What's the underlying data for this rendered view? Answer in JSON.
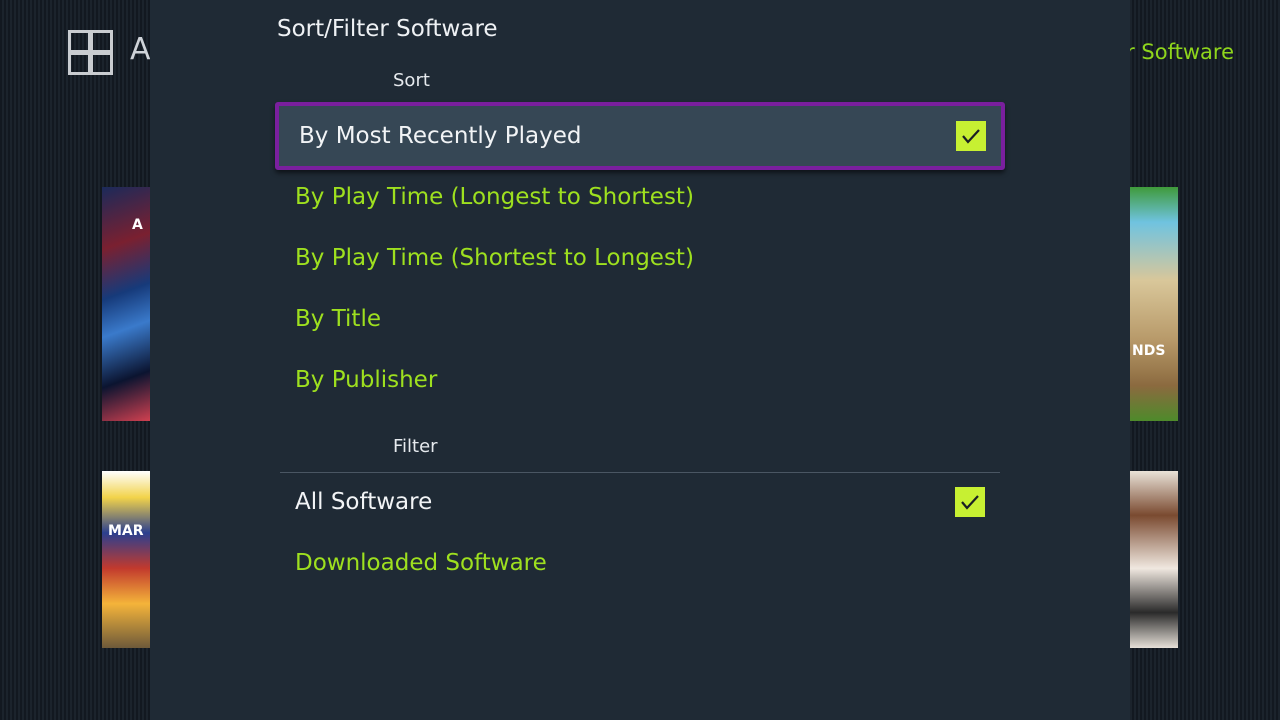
{
  "background": {
    "title_partial": "A",
    "right_label_partial": "r Software",
    "tiles": [
      {
        "name": "game-tile-left-1",
        "text": "A"
      },
      {
        "name": "game-tile-left-2",
        "text": "MAR"
      },
      {
        "name": "game-tile-right-1",
        "text": "NDS"
      },
      {
        "name": "game-tile-right-2",
        "text": ""
      }
    ]
  },
  "dialog": {
    "title": "Sort/Filter Software",
    "sort": {
      "label": "Sort",
      "options": [
        {
          "label": "By Most Recently Played",
          "selected": true
        },
        {
          "label": "By Play Time (Longest to Shortest)",
          "selected": false
        },
        {
          "label": "By Play Time (Shortest to Longest)",
          "selected": false
        },
        {
          "label": "By Title",
          "selected": false
        },
        {
          "label": "By Publisher",
          "selected": false
        }
      ]
    },
    "filter": {
      "label": "Filter",
      "options": [
        {
          "label": "All Software",
          "selected": true
        },
        {
          "label": "Downloaded Software",
          "selected": false
        }
      ]
    }
  },
  "colors": {
    "accent_green": "#9ee01f",
    "focus_border": "#7a1f9e",
    "check_fill": "#c7f032",
    "panel_bg": "#1f2a35"
  },
  "icons": {
    "grid": "all-software-grid-icon",
    "check": "checkmark-icon"
  }
}
